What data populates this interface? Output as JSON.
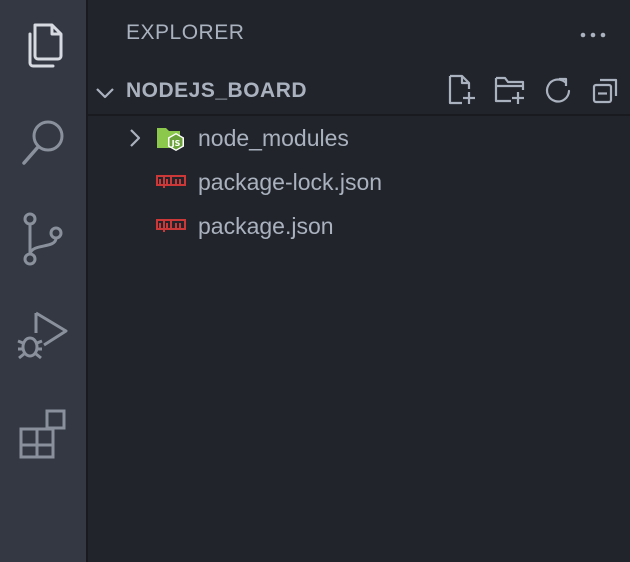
{
  "explorer": {
    "title": "EXPLORER",
    "more_actions_icon": "ellipsis-icon"
  },
  "activity_bar": {
    "items": [
      {
        "name": "explorer",
        "icon": "files-icon",
        "active": true
      },
      {
        "name": "search",
        "icon": "search-icon",
        "active": false
      },
      {
        "name": "source-control",
        "icon": "source-control-icon",
        "active": false
      },
      {
        "name": "run-and-debug",
        "icon": "run-debug-icon",
        "active": false
      },
      {
        "name": "extensions",
        "icon": "extensions-icon",
        "active": false
      }
    ]
  },
  "folder": {
    "name": "NODEJS_BOARD",
    "actions": [
      {
        "name": "new-file",
        "icon": "new-file-icon"
      },
      {
        "name": "new-folder",
        "icon": "new-folder-icon"
      },
      {
        "name": "refresh",
        "icon": "refresh-icon"
      },
      {
        "name": "collapse-all",
        "icon": "collapse-all-icon"
      }
    ]
  },
  "tree": {
    "items": [
      {
        "label": "node_modules",
        "type": "folder",
        "icon": "nodejs-folder-icon"
      },
      {
        "label": "package-lock.json",
        "type": "file",
        "icon": "npm-icon"
      },
      {
        "label": "package.json",
        "type": "file",
        "icon": "npm-icon"
      }
    ]
  },
  "colors": {
    "activity_bar_bg": "#333842",
    "sidebar_bg": "#21252b",
    "active_icon": "#d7dae0",
    "inactive_icon": "#8a919d",
    "text": "#abb2bf",
    "npm_red": "#cb3837",
    "node_green": "#8cc84b"
  }
}
